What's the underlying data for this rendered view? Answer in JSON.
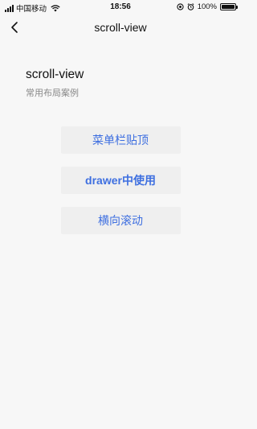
{
  "status": {
    "carrier": "中国移动",
    "time": "18:56",
    "battery": "100%",
    "battery_level": 1.0,
    "icons": [
      "signal-icon",
      "wifi-icon",
      "location-icon",
      "alarm-icon",
      "battery-icon"
    ]
  },
  "nav": {
    "title": "scroll-view",
    "back_icon": "chevron-left-icon"
  },
  "header": {
    "title": "scroll-view",
    "subtitle": "常用布局案例"
  },
  "buttons": [
    {
      "label": "菜单栏贴顶"
    },
    {
      "label": "drawer中使用"
    },
    {
      "label": "横向滚动"
    }
  ],
  "colors": {
    "background": "#f7f7f7",
    "button_bg": "#efefef",
    "button_text": "#3e6fe0"
  }
}
